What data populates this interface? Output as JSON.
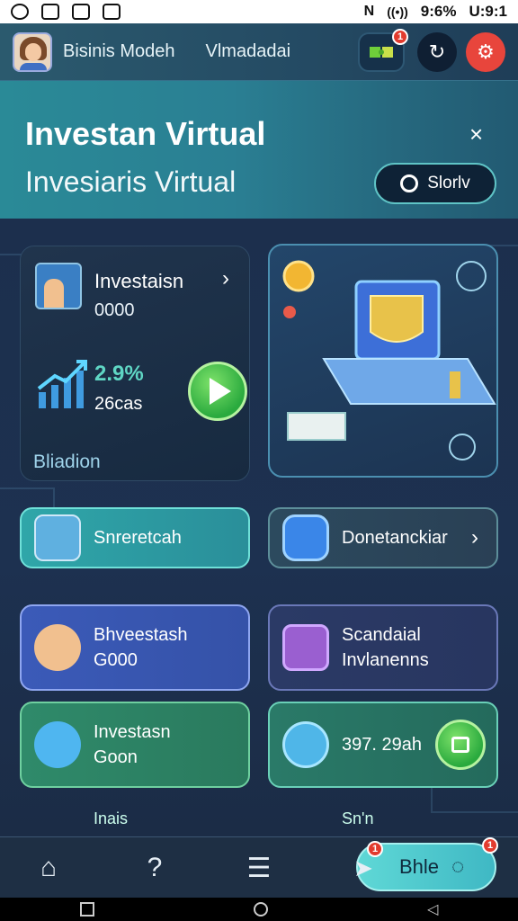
{
  "status_bar": {
    "right_text": "9:6% ",
    "time": "U:9:1"
  },
  "header": {
    "title": "Bisinis Modeh",
    "subtitle": "Vlmadadai",
    "game_badge": "1"
  },
  "banner": {
    "title": "Investan Virtual",
    "subtitle": "Invesiaris Virtual",
    "close": "×",
    "button_label": "Slorlv"
  },
  "invest_card": {
    "title": "Investaisn",
    "value": "0000",
    "percent": "2.9%",
    "subtext": "26cas",
    "footer": "Bliadion"
  },
  "rows": [
    {
      "label_line1": "Snreretcah",
      "label_line2": ""
    },
    {
      "label_line1": "Donetanckiar",
      "label_line2": ""
    },
    {
      "label_line1": "Bhveestash",
      "label_line2": "G000"
    },
    {
      "label_line1": "Scandaial",
      "label_line2": "Invlanenns"
    },
    {
      "label_line1": "Investasn",
      "label_line2": "Goon"
    },
    {
      "label_line1": "397. 29ah",
      "label_line2": ""
    }
  ],
  "peek": {
    "left": "Inais",
    "right": "Sn'n"
  },
  "bottom_nav": {
    "pill_label": "Bhle",
    "pill_badge": "1",
    "chat_badge": "1"
  },
  "colors": {
    "accent_teal": "#2a8a97",
    "alert_red": "#e8453c",
    "success_green": "#2aaa3e"
  }
}
